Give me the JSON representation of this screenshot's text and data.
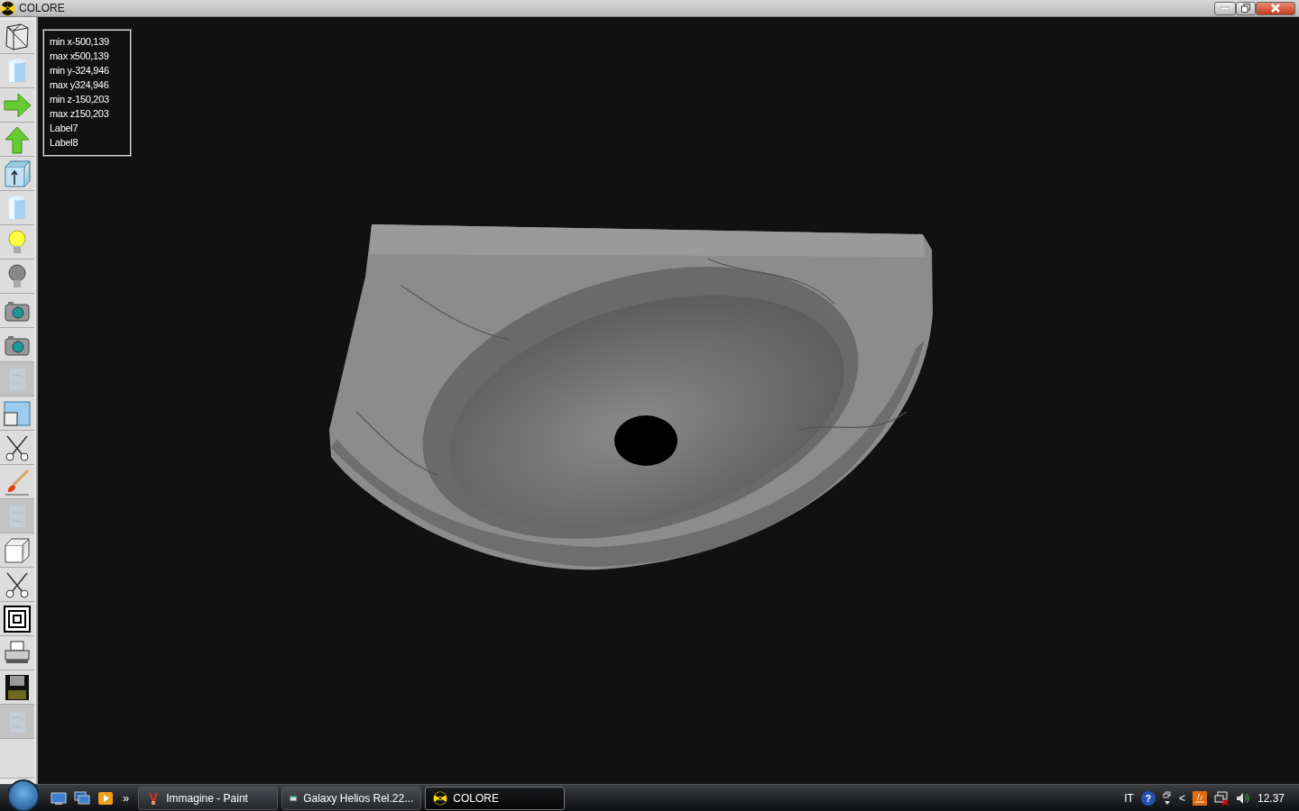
{
  "window": {
    "title": "COLORE"
  },
  "toolbar": [
    {
      "kind": "wireframe",
      "disabled": false
    },
    {
      "kind": "cylinder",
      "disabled": false
    },
    {
      "kind": "arrow-right",
      "disabled": false
    },
    {
      "kind": "arrow-up",
      "disabled": false
    },
    {
      "kind": "cube-arrow",
      "disabled": false
    },
    {
      "kind": "cylinder",
      "disabled": false
    },
    {
      "kind": "bulb-on",
      "disabled": false
    },
    {
      "kind": "bulb-off",
      "disabled": false
    },
    {
      "kind": "camera",
      "disabled": false
    },
    {
      "kind": "camera",
      "disabled": false
    },
    {
      "kind": "texture",
      "disabled": true
    },
    {
      "kind": "window",
      "disabled": false
    },
    {
      "kind": "scissors",
      "disabled": false
    },
    {
      "kind": "brush",
      "disabled": false
    },
    {
      "kind": "texture",
      "disabled": true
    },
    {
      "kind": "cube",
      "disabled": false
    },
    {
      "kind": "scissors",
      "disabled": false
    },
    {
      "kind": "squares",
      "disabled": false
    },
    {
      "kind": "printer",
      "disabled": false
    },
    {
      "kind": "floppy",
      "disabled": false
    },
    {
      "kind": "texture",
      "disabled": true
    },
    {
      "kind": "blank",
      "disabled": false
    }
  ],
  "info_box": [
    "min x-500,139",
    "max x500,139",
    "min y-324,946",
    "max y324,946",
    "min z-150,203",
    "max z150,203",
    "Label7",
    "Label8"
  ],
  "taskbar": {
    "overflow": "»",
    "tasks": [
      {
        "label": "Immagine - Paint",
        "kind": "paint",
        "selected": false
      },
      {
        "label": "Galaxy Helios  Rel.22...",
        "kind": "app",
        "selected": false
      },
      {
        "label": "COLORE",
        "kind": "colore",
        "selected": true
      }
    ],
    "language": "IT",
    "help": "?",
    "tray_chevron": "<",
    "clock": "12.37"
  }
}
